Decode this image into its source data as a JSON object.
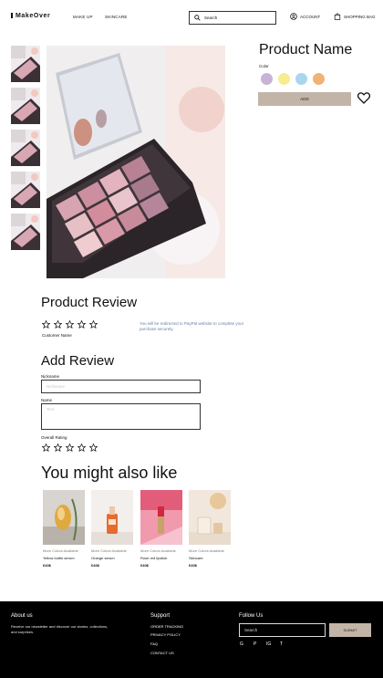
{
  "header": {
    "brand": "MakeOver",
    "nav": [
      "MAKE UP",
      "SKINCARE"
    ],
    "search_label": "Search",
    "account_label": "ACCOUNT",
    "bag_label": "SHOPPING BAG"
  },
  "product": {
    "name": "Product  Name",
    "color_label": "Color",
    "swatches": [
      "#c8b3d6",
      "#f7ec8e",
      "#a8d6ef",
      "#f1b276"
    ],
    "add_label": "ADD"
  },
  "review": {
    "title": "Product Review",
    "rating_stars": 5,
    "customer_label": "Customer Name",
    "paypal_note": "You will be redirected to PayPal website to complete your purchase securely."
  },
  "add_review": {
    "title": "Add Review",
    "nickname_label": "Nickname",
    "nickname_placeholder": "Nickname",
    "name_label": "Name",
    "name_placeholder": "Text",
    "overall_label": "Overall Rating"
  },
  "recommend": {
    "title": "You might also like",
    "items": [
      {
        "more": "More Colors Available",
        "name": "Yellow bottle serum",
        "price": "€40$"
      },
      {
        "more": "More Colors Available",
        "name": "Orange serum",
        "price": "€40$"
      },
      {
        "more": "More Colors Available",
        "name": "Rose red lipstick",
        "price": "€40$"
      },
      {
        "more": "More Colors Available",
        "name": "Skincare",
        "price": "€40$"
      }
    ]
  },
  "footer": {
    "about_title": "About us",
    "about_text": "Receive our newsletter and discover our stories, collections, and surprises.",
    "support_title": "Support",
    "support_links": [
      "ORDER TRACKING",
      "PRIVACY POLICY",
      "FAQ",
      "CONTACT US"
    ],
    "follow_title": "Follow Us",
    "search_placeholder": "Search",
    "submit_label": "SUBMIT",
    "social": [
      "G",
      "P",
      "IG",
      "T"
    ]
  }
}
